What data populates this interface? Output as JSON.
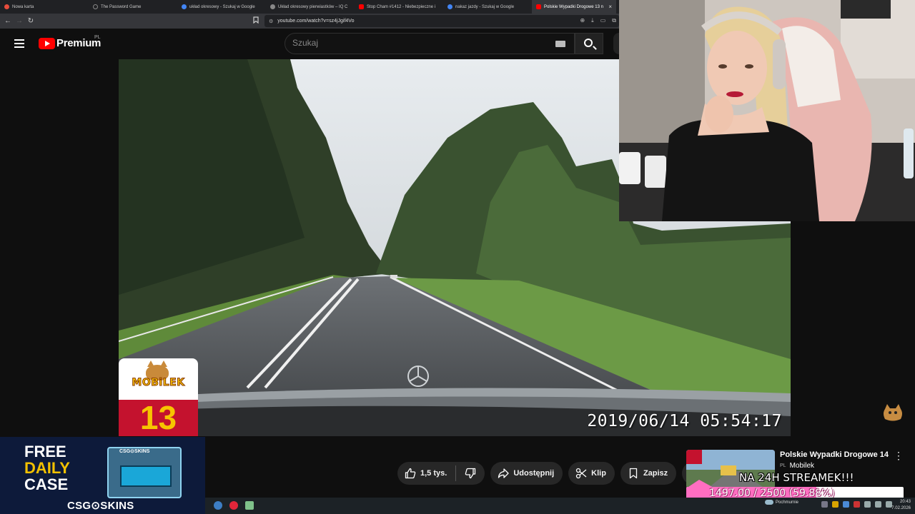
{
  "browser": {
    "tabs": [
      {
        "title": "Nowa karta",
        "active": false,
        "favicon_color": "#e74c3c"
      },
      {
        "title": "The Password Game",
        "active": false,
        "favicon_color": "#202124"
      },
      {
        "title": "układ okresowy - Szukaj w Google",
        "active": false,
        "favicon_color": "#4285f4"
      },
      {
        "title": "Układ okresowy pierwiastków – IQ C",
        "active": false,
        "favicon_color": "#888888"
      },
      {
        "title": "Stop Cham #1412 - Niebezpieczne i",
        "active": false,
        "favicon_color": "#ff0000"
      },
      {
        "title": "nakaz jazdy - Szukaj w Google",
        "active": false,
        "favicon_color": "#4285f4"
      },
      {
        "title": "Polskie Wypadki Drogowe 13 n",
        "active": true,
        "favicon_color": "#ff0000"
      }
    ],
    "close_glyph": "×",
    "url": "youtube.com/watch?v=sz4jJgif4Vo",
    "nav": {
      "back": "←",
      "forward": "→",
      "reload": "↻"
    }
  },
  "youtube": {
    "brand": "Premium",
    "region": "PL",
    "search_placeholder": "Szukaj"
  },
  "video": {
    "timestamp": "2019/06/14 05:54:17",
    "badge_brand": "MOBiLEK",
    "badge_episode": "13"
  },
  "actions": {
    "like_count": "1,5 tys.",
    "share_label": "Udostępnij",
    "clip_label": "Klip",
    "save_label": "Zapisz",
    "more_glyph": "•••"
  },
  "ad": {
    "line1": "FREE",
    "line2": "DAILY",
    "line3": "CASE",
    "crate_label": "CSG⊙SKINS",
    "brand": "CSG⊙SKINS"
  },
  "recommended": {
    "title": "Polskie Wypadki Drogowe  14",
    "channel_prefix": "PL",
    "channel": "Mobilek",
    "more_glyph": "⋮"
  },
  "stream_overlay": {
    "text": "NA 24H STREAMEK!!!",
    "goal_text": "1497.00 / 2500 (59.88%)",
    "goal_fraction": 0.5988,
    "goal_color": "#ff6ec1"
  },
  "taskbar": {
    "weather": "Pochmurnie",
    "clock_time": "20:43",
    "clock_date": "7.02.2026"
  }
}
